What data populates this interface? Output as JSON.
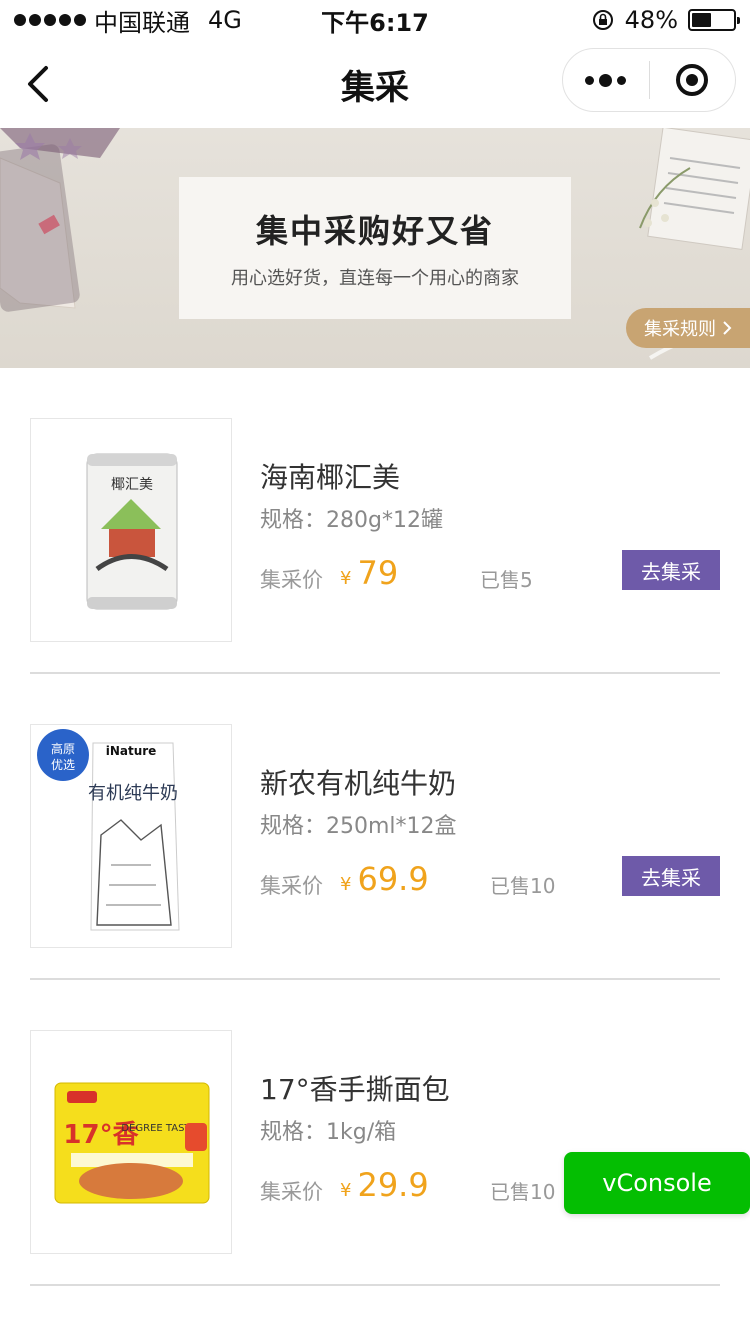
{
  "status_bar": {
    "carrier": "中国联通",
    "network": "4G",
    "time": "下午6:17",
    "battery_text": "48%",
    "battery_level": 0.48
  },
  "nav": {
    "title": "集采"
  },
  "banner": {
    "title": "集中采购好又省",
    "subtitle": "用心选好货，直连每一个用心的商家",
    "rules_label": "集采规则"
  },
  "products": [
    {
      "name": "海南椰汇美",
      "spec": "规格：280g*12罐",
      "price_label": "集采价",
      "currency": "¥",
      "price": "79",
      "sold": "已售5",
      "buy_label": "去集采"
    },
    {
      "name": "新农有机纯牛奶",
      "spec": "规格：250ml*12盒",
      "price_label": "集采价",
      "currency": "¥",
      "price": "69.9",
      "sold": "已售10",
      "buy_label": "去集采"
    },
    {
      "name": "17°香手撕面包",
      "spec": "规格：1kg/箱",
      "price_label": "集采价",
      "currency": "¥",
      "price": "29.9",
      "sold": "已售10"
    }
  ],
  "images": {
    "milk_badge_line1": "高原",
    "milk_badge_line2": "优选",
    "milk_brand": "iNature",
    "milk_box_text": "有机纯牛奶",
    "bread_brand": "17°香",
    "bread_sub": "DEGREE TASTY",
    "coconut_label": "椰汇美"
  },
  "vconsole_label": "vConsole",
  "colors": {
    "accent_price": "#f0a31c",
    "buy_button": "#6e5aa9",
    "rules_button": "#c8a472",
    "vconsole": "#04be02"
  }
}
